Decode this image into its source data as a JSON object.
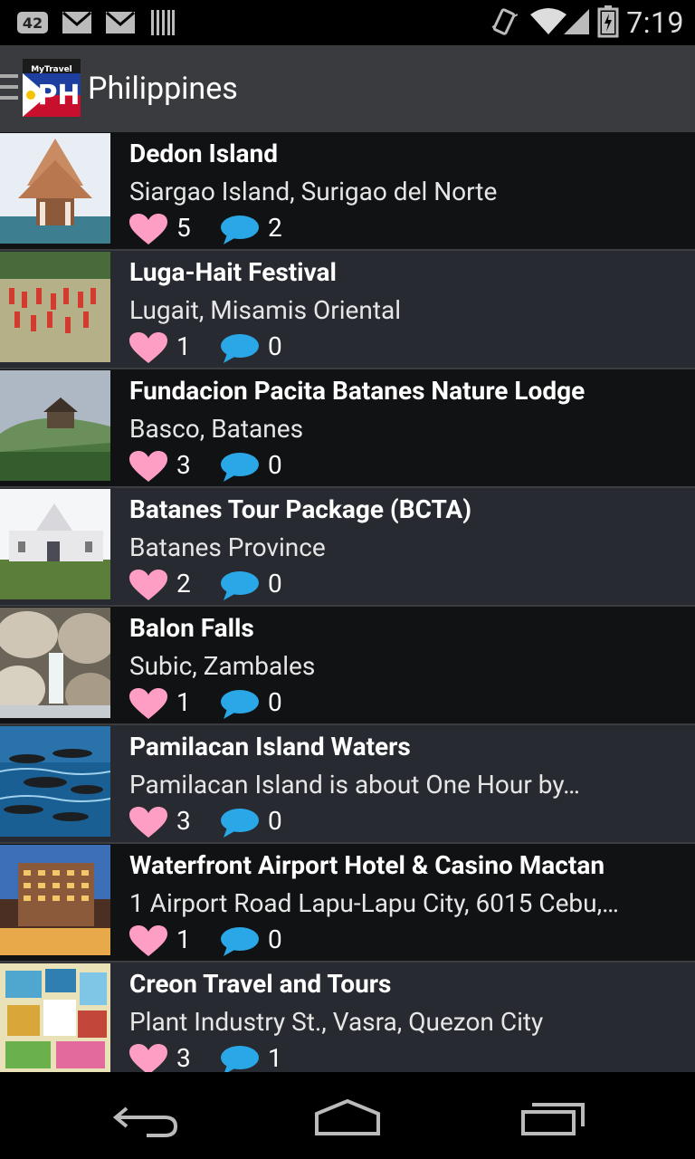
{
  "status_bar": {
    "notification_count": "42",
    "time": "7:19",
    "icons": [
      "notification-badge-icon",
      "gmail-icon",
      "gmail-icon",
      "barcode-icon",
      "vibrate-icon",
      "wifi-icon",
      "signal-icon",
      "battery-icon"
    ]
  },
  "action_bar": {
    "logo_caption": "MyTravel",
    "logo_text": "PH",
    "title": "Philippines"
  },
  "colors": {
    "action_bar_bg": "#3a3b3e",
    "row_dark": "#111214",
    "row_light": "#272a30",
    "heart": "#ff9ec5",
    "bubble": "#2aa7e6"
  },
  "list": {
    "items": [
      {
        "title": "Dedon Island",
        "subtitle": "Siargao Island, Surigao del Norte",
        "likes": "5",
        "comments": "2",
        "thumb": "beach-gazebo"
      },
      {
        "title": "Luga-Hait Festival",
        "subtitle": "Lugait,  Misamis Oriental",
        "likes": "1",
        "comments": "0",
        "thumb": "festival-dancers"
      },
      {
        "title": "Fundacion Pacita Batanes Nature Lodge",
        "subtitle": "Basco, Batanes",
        "likes": "3",
        "comments": "0",
        "thumb": "hill-lodge"
      },
      {
        "title": "Batanes Tour Package (BCTA)",
        "subtitle": "Batanes Province",
        "likes": "2",
        "comments": "0",
        "thumb": "white-church"
      },
      {
        "title": "Balon Falls",
        "subtitle": "Subic, Zambales",
        "likes": "1",
        "comments": "0",
        "thumb": "rock-falls"
      },
      {
        "title": "Pamilacan Island Waters",
        "subtitle": "Pamilacan Island is about One Hour by…",
        "likes": "3",
        "comments": "0",
        "thumb": "ocean-dolphins"
      },
      {
        "title": "Waterfront Airport Hotel & Casino Mactan",
        "subtitle": "1 Airport Road Lapu-Lapu City, 6015 Cebu,…",
        "likes": "1",
        "comments": "0",
        "thumb": "hotel-night"
      },
      {
        "title": "Creon Travel and Tours",
        "subtitle": "Plant Industry St., Vasra, Quezon City",
        "likes": "3",
        "comments": "1",
        "thumb": "travel-collage"
      }
    ]
  },
  "nav_bar": {
    "buttons": [
      "back-icon",
      "home-icon",
      "recent-apps-icon"
    ]
  }
}
